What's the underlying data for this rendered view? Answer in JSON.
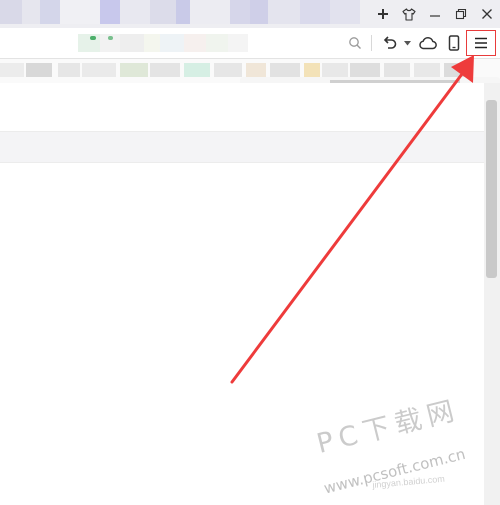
{
  "window": {
    "new_tab_icon": "plus-icon",
    "skin_icon": "tshirt-icon",
    "minimize_icon": "minimize-icon",
    "restore_icon": "restore-icon",
    "close_icon": "close-icon"
  },
  "toolbar": {
    "search_icon": "search-icon",
    "undo_icon": "undo-icon",
    "undo_dropdown_icon": "chevron-down-icon",
    "cloud_icon": "cloud-icon",
    "phone_icon": "phone-icon",
    "menu_icon": "hamburger-menu-icon"
  },
  "annotation": {
    "highlight_color": "#e83b3b",
    "arrow_color": "#ee3b3b"
  },
  "watermark": {
    "brand": "PC下载网",
    "url": "www.pcsoft.com.cn",
    "sub": "jingyan.baidu.com"
  },
  "colors": {
    "tab_strip": "#eeeef2",
    "toolbar": "#ffffff",
    "scrollbar_thumb": "#c9c9c9"
  }
}
